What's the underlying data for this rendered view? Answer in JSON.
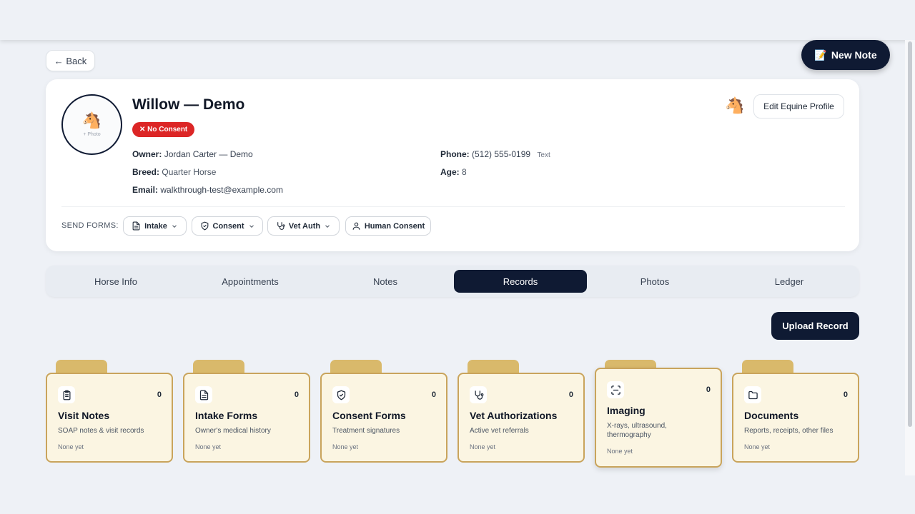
{
  "header": {
    "back_label": "← Back",
    "new_note_icon": "📝",
    "new_note_label": "New Note"
  },
  "profile": {
    "avatar_emoji": "🐴",
    "avatar_caption": "+ Photo",
    "name": "Willow — Demo",
    "consent_badge": "✕ No Consent",
    "owner_label": "Owner:",
    "owner": "Jordan Carter — Demo",
    "breed_label": "Breed:",
    "breed": "Quarter Horse",
    "email_label": "Email:",
    "email": "walkthrough-test@example.com",
    "phone_label": "Phone:",
    "phone": "(512) 555-0199",
    "phone_tag": "Text",
    "age_label": "Age:",
    "age": "8",
    "horse_emoji": "🐴",
    "edit_label": "Edit Equine Profile",
    "send_forms_label": "SEND FORMS:",
    "forms": [
      {
        "label": "Intake",
        "icon": "document-icon"
      },
      {
        "label": "Consent",
        "icon": "shield-icon"
      },
      {
        "label": "Vet Auth",
        "icon": "stethoscope-icon"
      },
      {
        "label": "Human Consent",
        "icon": "user-icon"
      }
    ]
  },
  "tabs": [
    "Horse Info",
    "Appointments",
    "Notes",
    "Records",
    "Photos",
    "Ledger"
  ],
  "active_tab": "Records",
  "upload_label": "Upload Record",
  "folders": [
    {
      "title": "Visit Notes",
      "desc": "SOAP notes & visit records",
      "count": "0",
      "status": "None yet",
      "icon": "clipboard-icon"
    },
    {
      "title": "Intake Forms",
      "desc": "Owner's medical history",
      "count": "0",
      "status": "None yet",
      "icon": "document-icon"
    },
    {
      "title": "Consent Forms",
      "desc": "Treatment signatures",
      "count": "0",
      "status": "None yet",
      "icon": "shield-icon"
    },
    {
      "title": "Vet Authorizations",
      "desc": "Active vet referrals",
      "count": "0",
      "status": "None yet",
      "icon": "stethoscope-icon"
    },
    {
      "title": "Imaging",
      "desc": "X-rays, ultrasound, thermography",
      "count": "0",
      "status": "None yet",
      "icon": "scan-icon"
    },
    {
      "title": "Documents",
      "desc": "Reports, receipts, other files",
      "count": "0",
      "status": "None yet",
      "icon": "folder-icon"
    }
  ]
}
